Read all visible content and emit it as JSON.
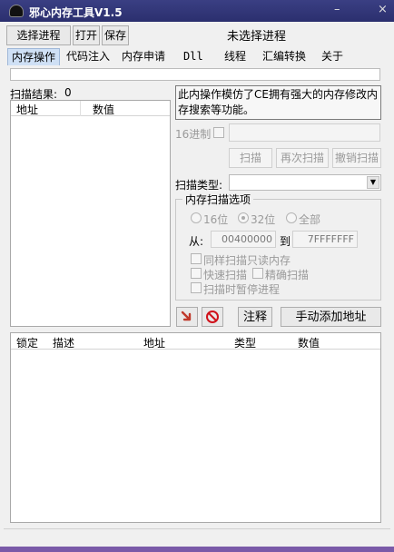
{
  "window": {
    "title": "邪心内存工具V1.5",
    "minimize_glyph": "–",
    "close_glyph": "×",
    "accent": "#2b2f6e"
  },
  "toolbar": {
    "select_process": "选择进程",
    "open": "打开",
    "save": "保存",
    "status": "未选择进程"
  },
  "tabs": [
    "内存操作",
    "代码注入",
    "内存申请",
    "Dll",
    "线程",
    "汇编转换",
    "关于"
  ],
  "scan": {
    "result_label": "扫描结果:",
    "result_count": "0",
    "columns": [
      "地址",
      "数值"
    ],
    "description": "此内操作模仿了CE拥有强大的内存修改内存搜索等功能。",
    "hex_label": "16进制",
    "scan_button": "扫描",
    "rescan_button": "再次扫描",
    "cancel_button": "撤销扫描",
    "type_label": "扫描类型:",
    "type_value": "",
    "options_title": "内存扫描选项",
    "bit16": "16位",
    "bit32": "32位",
    "all": "全部",
    "from_label": "从:",
    "from_value": "00400000",
    "to_label": "到",
    "to_value": "7FFFFFFF",
    "opt_readonly": "同样扫描只读内存",
    "opt_fast": "快速扫描",
    "opt_exact": "精确扫描",
    "opt_pause": "扫描时暂停进程",
    "note_button": "注释",
    "add_address_button": "手动添加地址"
  },
  "bottom_table": {
    "columns": [
      "锁定",
      "描述",
      "地址",
      "类型",
      "数值"
    ]
  },
  "icons": {
    "arrow": "down-arrow-icon",
    "forbid": "no-entry-icon"
  }
}
